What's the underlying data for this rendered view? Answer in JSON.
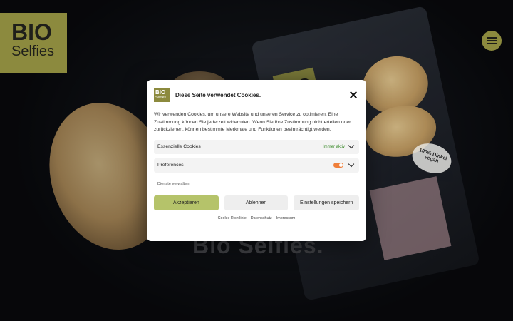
{
  "background": {
    "logo": {
      "line1": "BIO",
      "line2": "Selfies"
    },
    "package_logo": "BIO",
    "sticker_line1": "100% Dinkel",
    "sticker_line2": "vegan",
    "slogan": "Bio Selfies."
  },
  "dialog": {
    "logo_line1": "BIO",
    "logo_line2": "Selfies",
    "title": "Diese Seite verwendet Cookies.",
    "text": "Wir verwenden Cookies, um unsere Website und unseren Service zu optimieren. Eine Zustimmung können Sie jederzeit widerrufen. Wenn Sie Ihre Zustimmung nicht erteilen oder zurückziehen, können bestimmte Merkmale und Funktionen beeinträchtigt werden.",
    "categories": [
      {
        "label": "Essenzielle Cookies",
        "status": "Immer aktiv"
      },
      {
        "label": "Preferences",
        "enabled": true
      }
    ],
    "manage_link": "Dienste verwalten",
    "buttons": {
      "accept": "Akzeptieren",
      "deny": "Ablehnen",
      "settings": "Einstellungen speichern"
    },
    "footer_links": [
      "Cookie Richtlinie",
      "Datenschutz",
      "Impressum"
    ]
  },
  "colors": {
    "brand_olive": "#8c8a3e",
    "accept_green": "#b5c36a",
    "toggle_orange": "#ef7f3a",
    "always_active_green": "#3a8a2a"
  }
}
